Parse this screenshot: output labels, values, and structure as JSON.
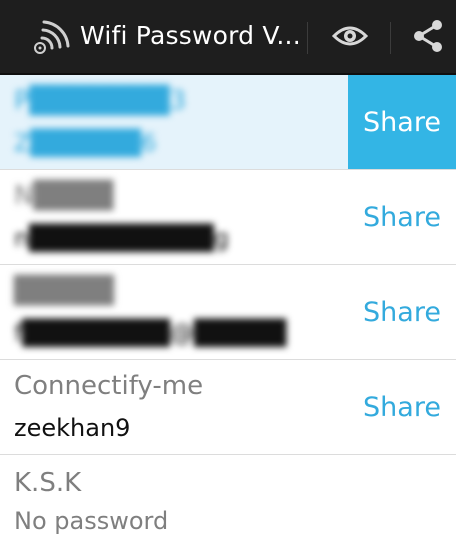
{
  "actionbar": {
    "title": "Wifi Password V...",
    "icons": [
      "wifi-app-icon",
      "eye-icon",
      "share-icon"
    ]
  },
  "networks": [
    {
      "name": "P███████3",
      "password": "Z██████6",
      "share_label": "Share",
      "selected": true,
      "redacted": true
    },
    {
      "name": "N████",
      "password": "n██████████g",
      "share_label": "Share",
      "selected": false,
      "redacted": true
    },
    {
      "name": "█████",
      "password": "f████████@█████",
      "share_label": "Share",
      "selected": false,
      "redacted": true
    },
    {
      "name": "Connectify-me",
      "password": "zeekhan9",
      "share_label": "Share",
      "selected": false,
      "redacted": false
    },
    {
      "name": "K.S.K",
      "password": "No password",
      "share_label": "",
      "selected": false,
      "redacted": false
    }
  ],
  "colors": {
    "accent": "#33b5e5",
    "actionbar": "#1e1e1e",
    "selected_row": "#e5f3fb"
  }
}
